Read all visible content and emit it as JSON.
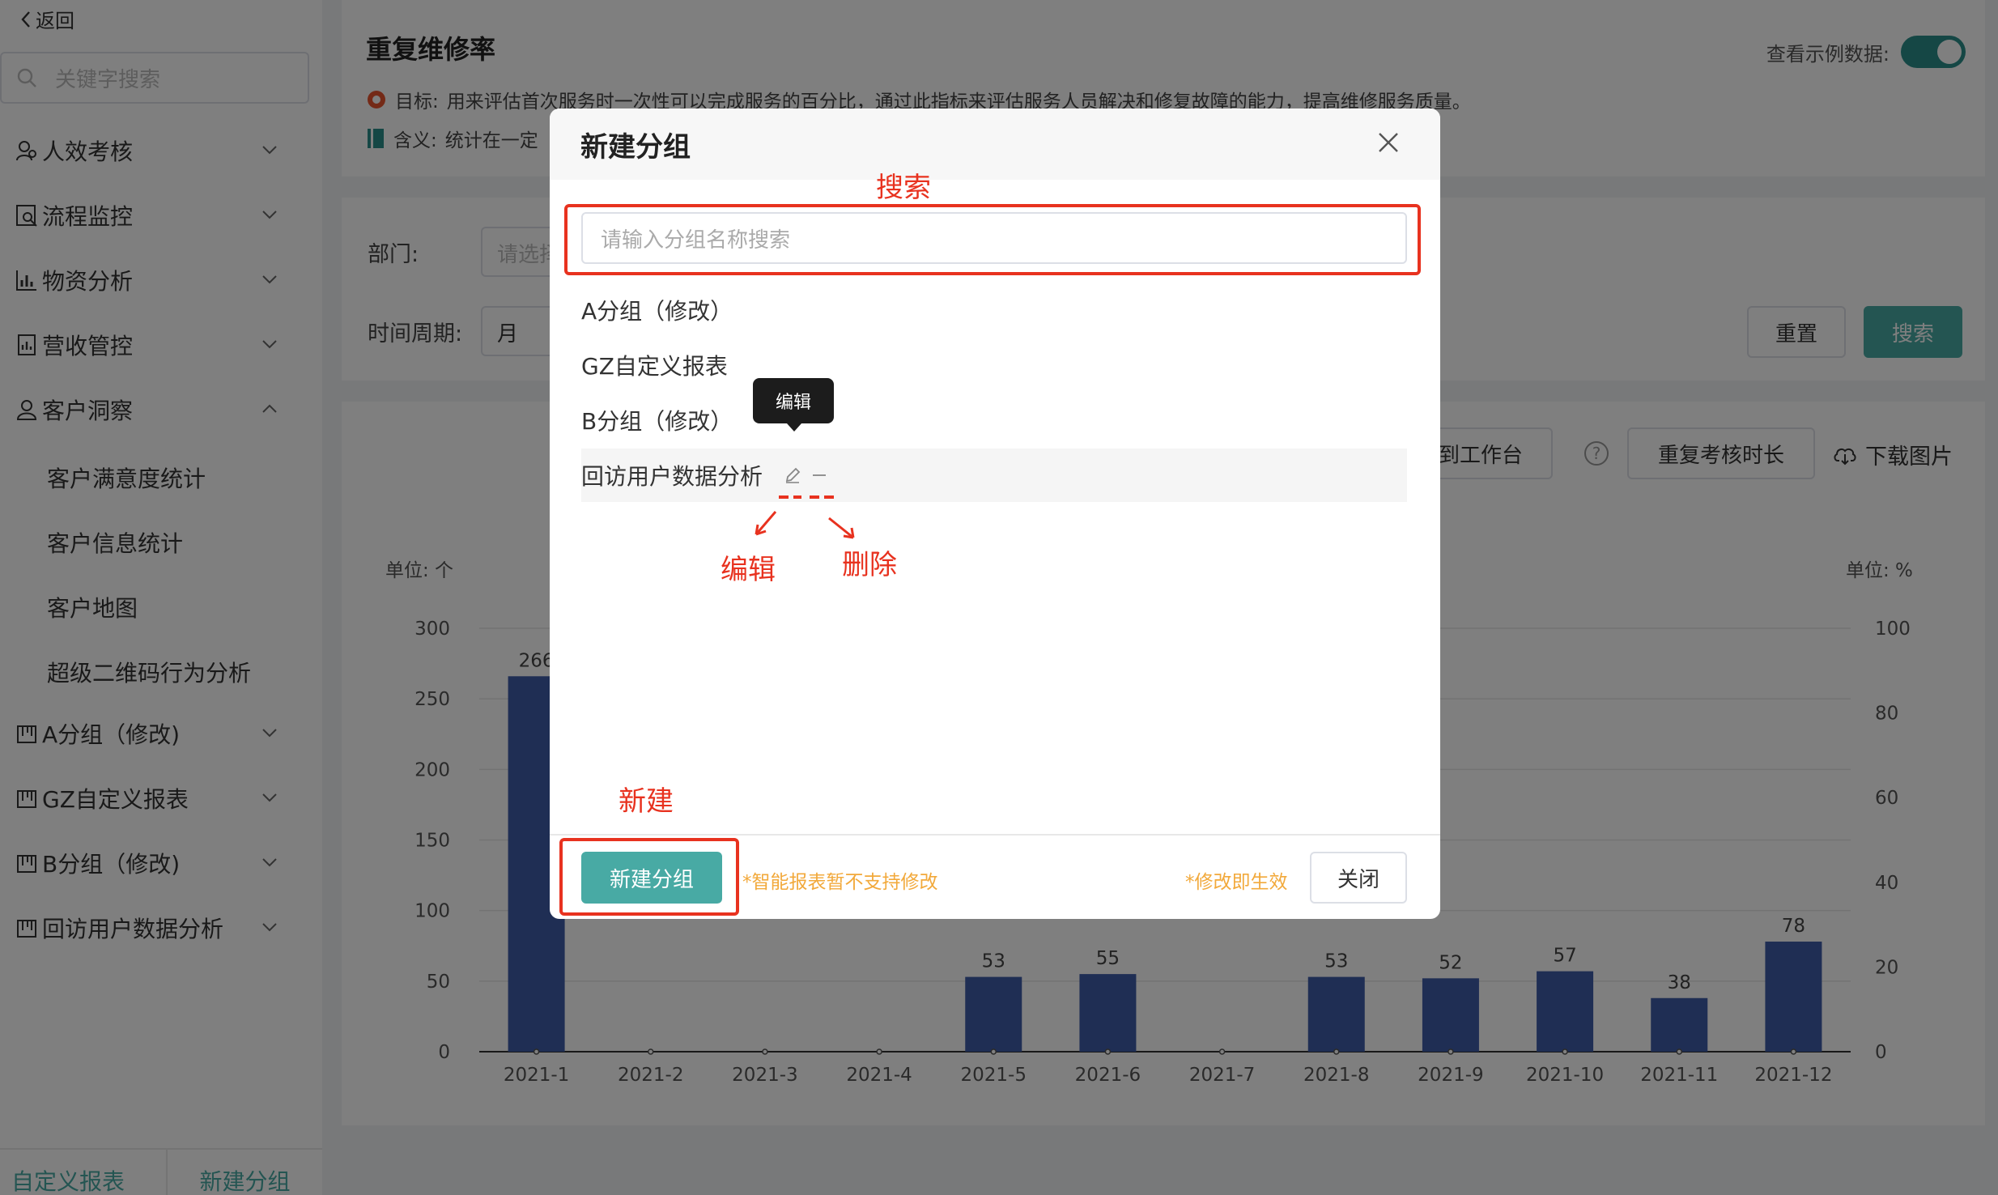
{
  "sidebar": {
    "back_label": "返回",
    "search_placeholder": "关键字搜索",
    "menu": [
      {
        "label": "人效考核",
        "icon": "people-icon"
      },
      {
        "label": "流程监控",
        "icon": "monitor-icon"
      },
      {
        "label": "物资分析",
        "icon": "bar-chart-icon"
      },
      {
        "label": "营收管控",
        "icon": "revenue-icon"
      },
      {
        "label": "客户洞察",
        "icon": "user-icon"
      }
    ],
    "sub_items": [
      "客户满意度统计",
      "客户信息统计",
      "客户地图",
      "超级二维码行为分析"
    ],
    "groups": [
      "A分组（修改)",
      "GZ自定义报表",
      "B分组（修改)",
      "回访用户数据分析"
    ],
    "footer": {
      "left": "自定义报表",
      "right": "新建分组"
    }
  },
  "page": {
    "title": "重复维修率",
    "goal_label": "目标:",
    "goal_text": "用来评估首次服务时一次性可以完成服务的百分比，通过此指标来评估服务人员解决和修复故障的能力，提高维修服务质量。",
    "meaning_label": "含义:",
    "meaning_text": "统计在一定",
    "toggle_label": "查看示例数据:",
    "toggle_on": true
  },
  "filters": {
    "dept_label": "部门:",
    "dept_placeholder": "请选择",
    "period_label": "时间周期:",
    "period_value": "月",
    "reset_label": "重置",
    "search_label": "搜索"
  },
  "chart_toolbar": {
    "to_workbench": "到工作台",
    "repeat_duration": "重复考核时长",
    "download": "下载图片"
  },
  "chart_data": {
    "type": "bar",
    "left_unit": "单位: 个",
    "right_unit": "单位: %",
    "categories": [
      "2021-1",
      "2021-2",
      "2021-3",
      "2021-4",
      "2021-5",
      "2021-6",
      "2021-7",
      "2021-8",
      "2021-9",
      "2021-10",
      "2021-11",
      "2021-12"
    ],
    "visible_bars": [
      {
        "index": 0,
        "value": 266,
        "label": "266"
      },
      {
        "index": 4,
        "value": 53,
        "label": "53"
      },
      {
        "index": 5,
        "value": 55,
        "label": "55"
      },
      {
        "index": 7,
        "value": 53,
        "label": "53"
      },
      {
        "index": 8,
        "value": 52,
        "label": "52"
      },
      {
        "index": 9,
        "value": 57,
        "label": "57"
      },
      {
        "index": 10,
        "value": 38,
        "label": "38"
      },
      {
        "index": 11,
        "value": 78,
        "label": "78"
      }
    ],
    "y_left_ticks": [
      0,
      50,
      100,
      150,
      200,
      250,
      300
    ],
    "y_right_ticks": [
      0,
      20,
      40,
      60,
      80,
      100
    ],
    "ylim_left": [
      0,
      300
    ],
    "ylim_right": [
      0,
      100
    ],
    "colors": {
      "bar": "#3f5ca8",
      "line_dark": "#333a4e",
      "line_green": "#4a9a6a"
    }
  },
  "modal": {
    "title": "新建分组",
    "search_placeholder": "请输入分组名称搜索",
    "groups": [
      "A分组（修改）",
      "GZ自定义报表",
      "B分组（修改）",
      "回访用户数据分析"
    ],
    "tooltip": "编辑",
    "new_button": "新建分组",
    "note_left": "*智能报表暂不支持修改",
    "note_right": "*修改即生效",
    "close_button": "关闭"
  },
  "annotations": {
    "search": "搜索",
    "edit": "编辑",
    "delete": "删除",
    "new": "新建"
  }
}
